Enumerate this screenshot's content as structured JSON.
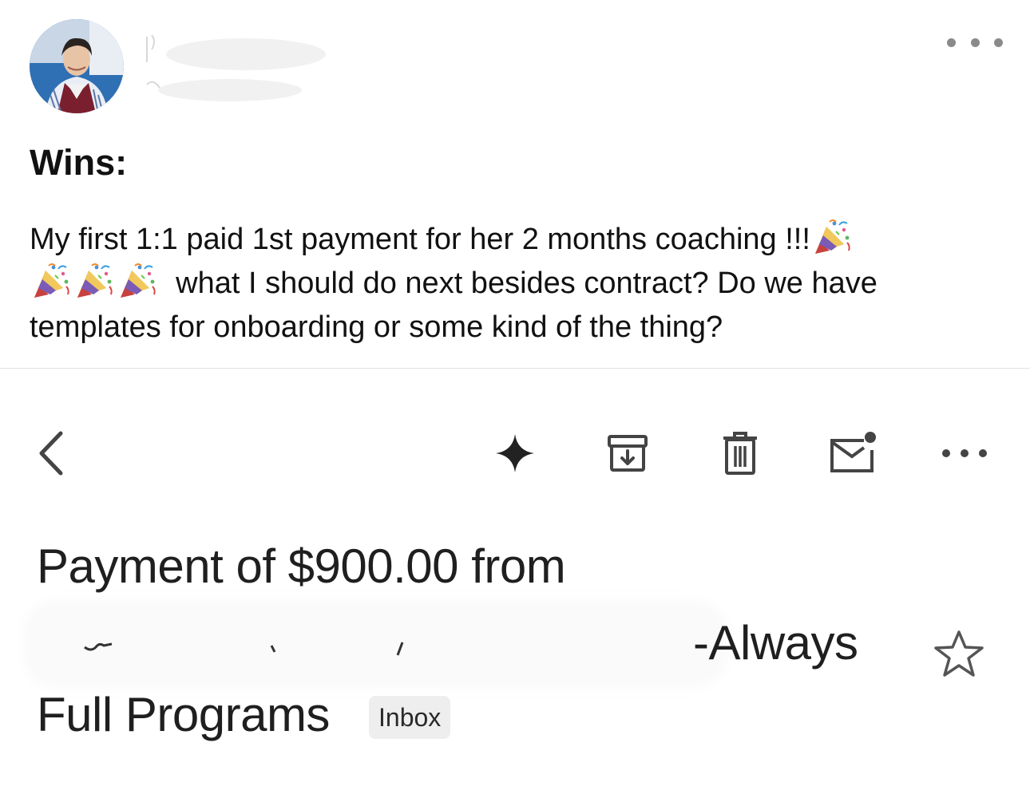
{
  "post": {
    "title": "Wins:",
    "body_line1": "My first 1:1 paid 1st payment for her 2 months coaching !!!",
    "body_line2": "what I should do next besides contract? Do we have",
    "body_line3": "templates for onboarding or some kind of the thing?",
    "emoji_name": "party-popper",
    "more_icon": "more-horizontal-icon"
  },
  "email": {
    "toolbar": {
      "back_icon": "chevron-left-icon",
      "sparkle_icon": "sparkle-icon",
      "archive_icon": "archive-icon",
      "delete_icon": "trash-icon",
      "mark_unread_icon": "mark-unread-icon",
      "more_icon": "more-horizontal-icon"
    },
    "subject_line1": "Payment of $900.00 from",
    "subject_line2_end": "-Always",
    "subject_line3": "Full Programs",
    "label": "Inbox",
    "star_icon": "star-outline-icon"
  }
}
